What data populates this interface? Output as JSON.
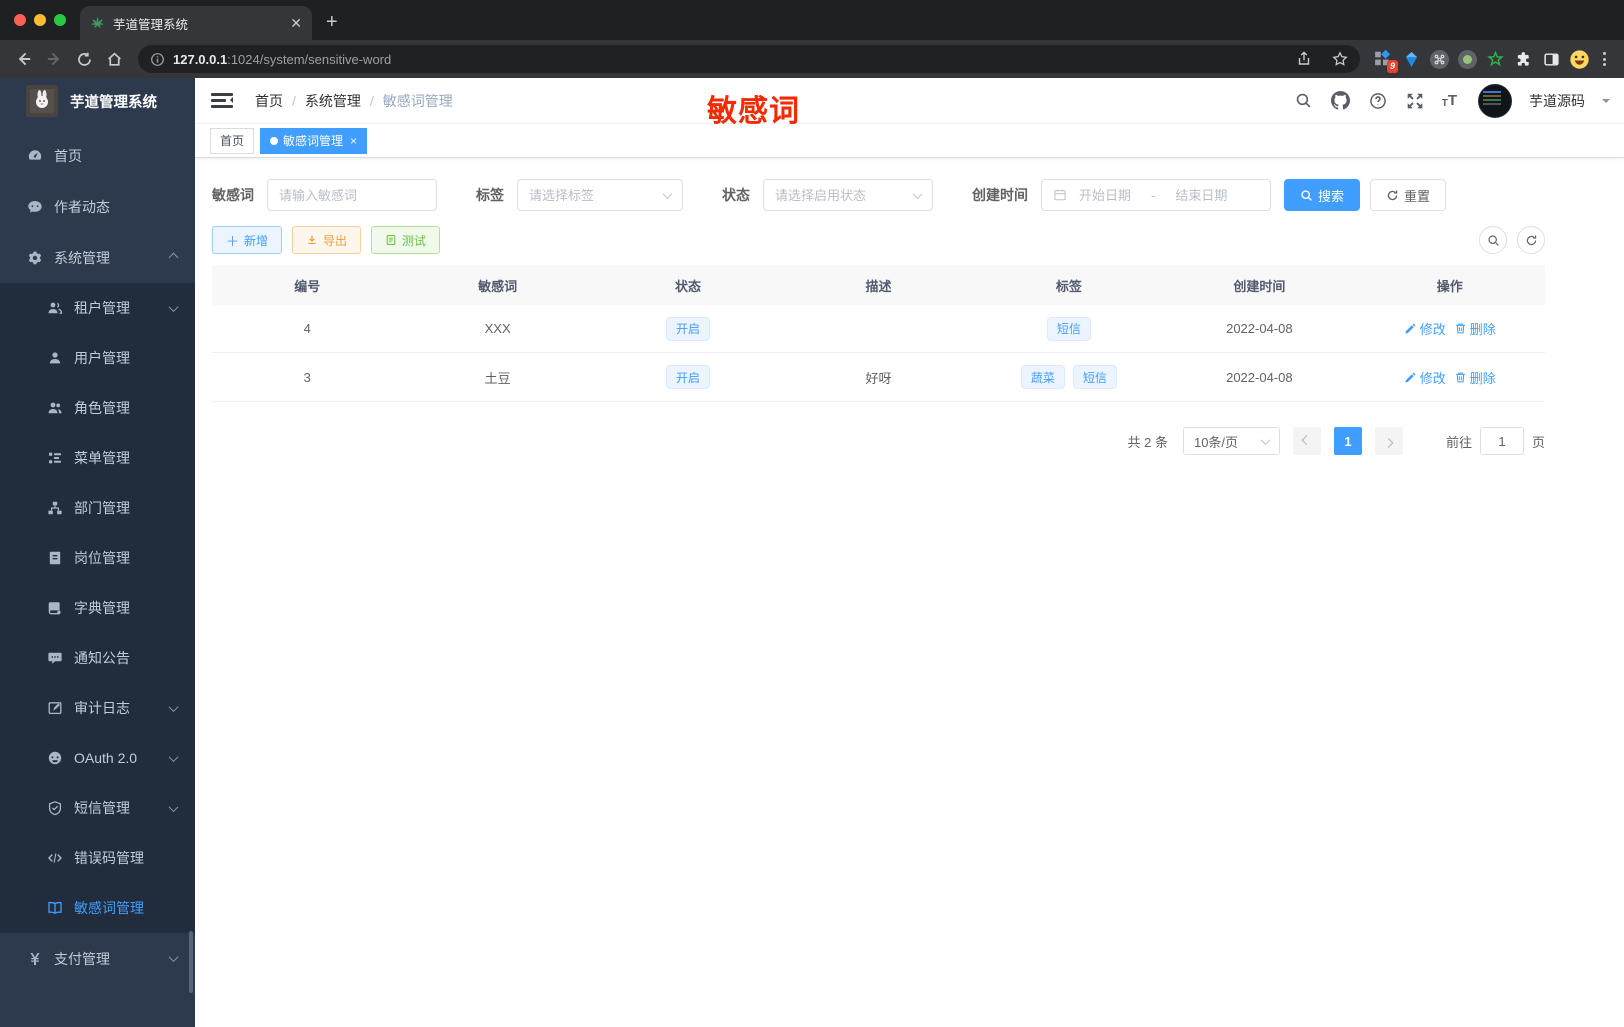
{
  "browser": {
    "tab_title": "芋道管理系统",
    "url_host": "127.0.0.1",
    "url_path": ":1024/system/sensitive-word",
    "extensions_badge": "9"
  },
  "sidebar": {
    "logo_title": "芋道管理系统",
    "items": [
      {
        "label": "首页",
        "icon": "dashboard-icon",
        "level": 1
      },
      {
        "label": "作者动态",
        "icon": "chat-icon",
        "level": 1
      },
      {
        "label": "系统管理",
        "icon": "gear-icon",
        "level": 1,
        "arrow": "up"
      },
      {
        "label": "租户管理",
        "icon": "tenant-icon",
        "level": 2,
        "arrow": "down"
      },
      {
        "label": "用户管理",
        "icon": "user-icon",
        "level": 2
      },
      {
        "label": "角色管理",
        "icon": "role-icon",
        "level": 2
      },
      {
        "label": "菜单管理",
        "icon": "menu-tree-icon",
        "level": 2
      },
      {
        "label": "部门管理",
        "icon": "dept-icon",
        "level": 2
      },
      {
        "label": "岗位管理",
        "icon": "post-icon",
        "level": 2
      },
      {
        "label": "字典管理",
        "icon": "dict-icon",
        "level": 2
      },
      {
        "label": "通知公告",
        "icon": "notice-icon",
        "level": 2
      },
      {
        "label": "审计日志",
        "icon": "audit-log-icon",
        "level": 2,
        "arrow": "down"
      },
      {
        "label": "OAuth 2.0",
        "icon": "oauth-icon",
        "level": 2,
        "arrow": "down"
      },
      {
        "label": "短信管理",
        "icon": "sms-shield-icon",
        "level": 2,
        "arrow": "down"
      },
      {
        "label": "错误码管理",
        "icon": "error-code-icon",
        "level": 2
      },
      {
        "label": "敏感词管理",
        "icon": "sensitive-word-icon",
        "level": 2,
        "active": true
      },
      {
        "label": "支付管理",
        "icon": "pay-yen-icon",
        "level": 1,
        "arrow": "down"
      }
    ]
  },
  "header": {
    "breadcrumb": [
      "首页",
      "系统管理",
      "敏感词管理"
    ],
    "separator": "/",
    "username": "芋道源码"
  },
  "annotation": "敏感词",
  "tags_view": {
    "tabs": [
      {
        "label": "首页",
        "active": false,
        "closable": false
      },
      {
        "label": "敏感词管理",
        "active": true,
        "closable": true
      }
    ]
  },
  "filters": {
    "keyword_label": "敏感词",
    "keyword_placeholder": "请输入敏感词",
    "tag_label": "标签",
    "tag_placeholder": "请选择标签",
    "status_label": "状态",
    "status_placeholder": "请选择启用状态",
    "date_label": "创建时间",
    "date_start_placeholder": "开始日期",
    "date_separator": "-",
    "date_end_placeholder": "结束日期",
    "search_label": "搜索",
    "reset_label": "重置"
  },
  "toolbar": {
    "add_label": "新增",
    "export_label": "导出",
    "test_label": "测试"
  },
  "table": {
    "columns": [
      "编号",
      "敏感词",
      "状态",
      "描述",
      "标签",
      "创建时间",
      "操作"
    ],
    "edit_label": "修改",
    "delete_label": "删除",
    "rows": [
      {
        "id": "4",
        "word": "XXX",
        "status": "开启",
        "description": "",
        "tags": [
          "短信"
        ],
        "create_time": "2022-04-08"
      },
      {
        "id": "3",
        "word": "土豆",
        "status": "开启",
        "description": "好呀",
        "tags": [
          "蔬菜",
          "短信"
        ],
        "create_time": "2022-04-08"
      }
    ]
  },
  "pagination": {
    "total_text": "共 2 条",
    "page_size": "10条/页",
    "current_page": "1",
    "goto_label": "前往",
    "goto_value": "1",
    "page_suffix": "页"
  },
  "colors": {
    "primary": "#409eff",
    "warning": "#e6a23c",
    "success": "#67c23a",
    "annotation_red": "#f42a00",
    "sidebar_bg": "#2d3a4d",
    "submenu_bg": "#212c3d",
    "tag_bg": "#ecf5ff"
  }
}
